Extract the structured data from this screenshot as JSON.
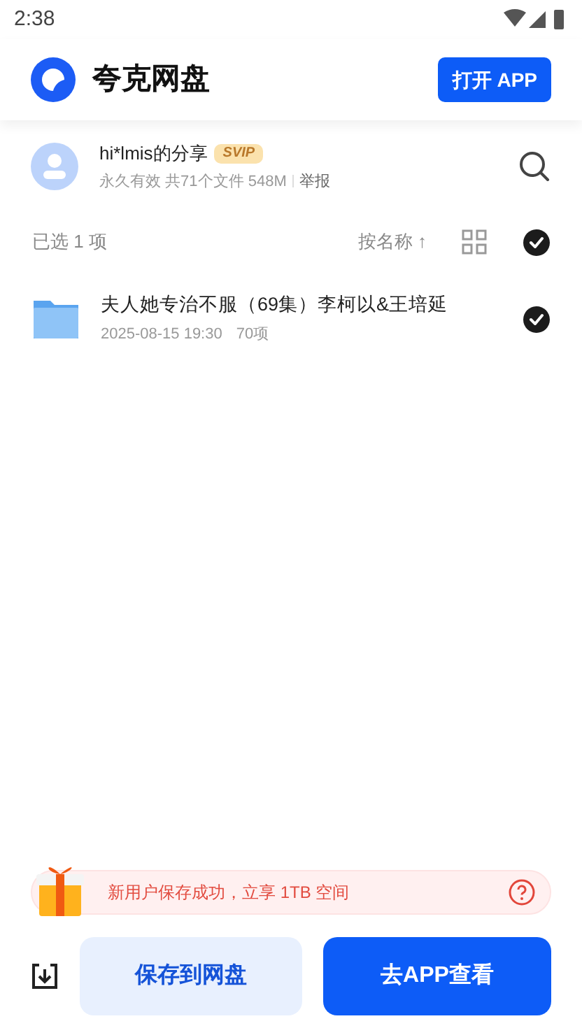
{
  "status_bar": {
    "time": "2:38"
  },
  "header": {
    "title": "夸克网盘",
    "open_button": "打开 APP"
  },
  "share": {
    "owner": "hi*lmis的分享",
    "badge": "SVIP",
    "meta": "永久有效 共71个文件 548M",
    "report": "举报"
  },
  "toolbar": {
    "selected_count": "已选 1 项",
    "sort": "按名称",
    "sort_arrow": "↑",
    "all_selected": true
  },
  "files": [
    {
      "name": "夫人她专治不服（69集）李柯以&王培延",
      "date": "2025-08-15 19:30",
      "count": "70项",
      "selected": true
    }
  ],
  "banner": {
    "text": "新用户保存成功，立享 1TB 空间"
  },
  "actions": {
    "save": "保存到网盘",
    "view": "去APP查看"
  }
}
